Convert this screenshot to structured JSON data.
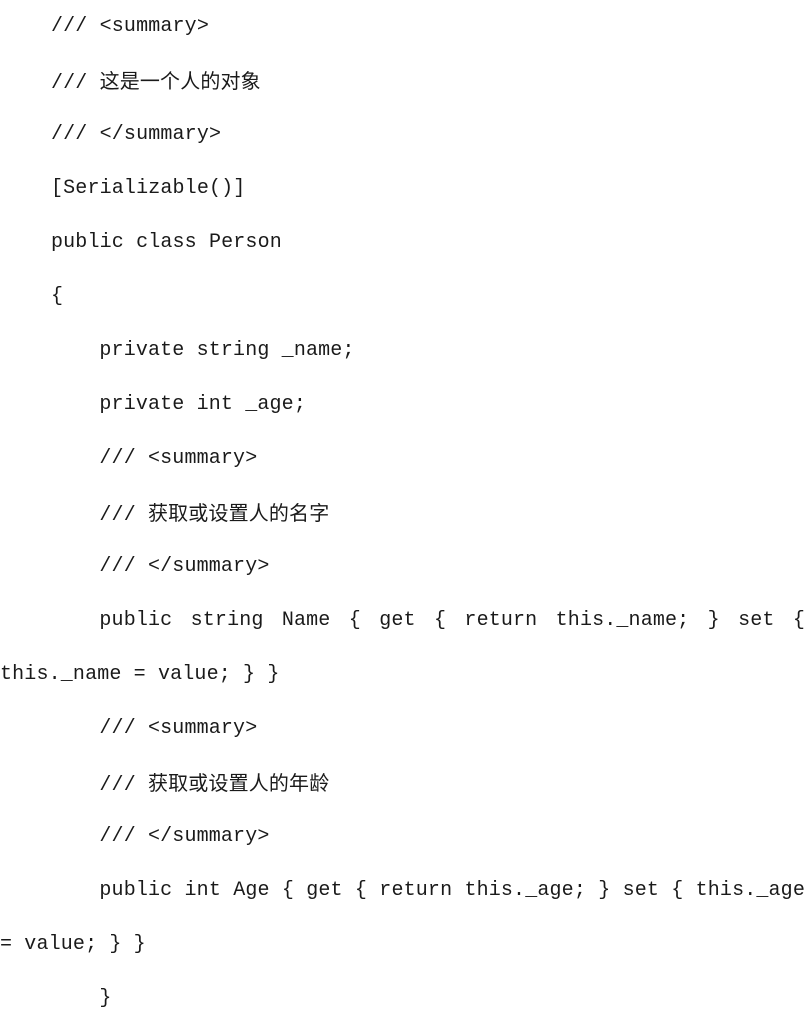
{
  "document": {
    "kind": "code-listing",
    "language": "C#",
    "background_color": "#ffffff",
    "text_color": "#1a1a1a",
    "lines": [
      {
        "id": "l1",
        "indent": 0,
        "text": "/// <summary>",
        "wrapped": false
      },
      {
        "id": "l2",
        "indent": 0,
        "text": "/// 这是一个人的对象",
        "wrapped": false
      },
      {
        "id": "l3",
        "indent": 0,
        "text": "/// </summary>",
        "wrapped": false
      },
      {
        "id": "l4",
        "indent": 0,
        "text": "[Serializable()]",
        "wrapped": false
      },
      {
        "id": "l5",
        "indent": 0,
        "text": "public class Person",
        "wrapped": false
      },
      {
        "id": "l6",
        "indent": 0,
        "text": "{",
        "wrapped": false
      },
      {
        "id": "l7",
        "indent": 1,
        "text": "private string _name;",
        "wrapped": false
      },
      {
        "id": "l8",
        "indent": 1,
        "text": "private int _age;",
        "wrapped": false
      },
      {
        "id": "l9",
        "indent": 1,
        "text": "/// <summary>",
        "wrapped": false
      },
      {
        "id": "l10",
        "indent": 1,
        "text": "/// 获取或设置人的名字",
        "wrapped": false
      },
      {
        "id": "l11",
        "indent": 1,
        "text": "/// </summary>",
        "wrapped": false
      },
      {
        "id": "l12",
        "indent": 1,
        "text": "public string Name { get { return this._name; } set { this._name = value; } }",
        "wrapped": true
      },
      {
        "id": "l13",
        "indent": 1,
        "text": "/// <summary>",
        "wrapped": false
      },
      {
        "id": "l14",
        "indent": 1,
        "text": "/// 获取或设置人的年龄",
        "wrapped": false
      },
      {
        "id": "l15",
        "indent": 1,
        "text": "/// </summary>",
        "wrapped": false
      },
      {
        "id": "l16",
        "indent": 1,
        "text": "public int Age { get { return this._age; } set { this._age = value; } }",
        "wrapped": true
      },
      {
        "id": "l17",
        "indent": 1,
        "text": "}",
        "wrapped": false
      }
    ]
  }
}
